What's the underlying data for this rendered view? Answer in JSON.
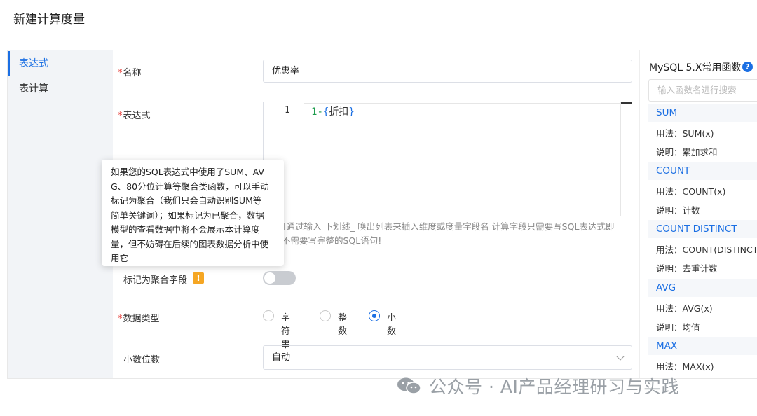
{
  "page": {
    "title": "新建计算度量"
  },
  "nav": {
    "items": [
      {
        "label": "表达式",
        "active": true
      },
      {
        "label": "表计算",
        "active": false
      }
    ]
  },
  "form": {
    "name": {
      "required_mark": "*",
      "label": "名称",
      "value": "优惠率"
    },
    "expression": {
      "required_mark": "*",
      "label": "表达式",
      "line_number": "1",
      "code": {
        "num": "1",
        "op": "-",
        "open": "{",
        "field": "折扣",
        "close": "}"
      },
      "hint_line1": "可通过输入 下划线_ 唤出列表来插入维度或度量字段名 计算字段只需要写SQL表达式即",
      "hint_line2": "不需要写完整的SQL语句!"
    },
    "aggregate": {
      "label": "标记为聚合字段",
      "warn_glyph": "!",
      "enabled": false
    },
    "data_type": {
      "required_mark": "*",
      "label": "数据类型",
      "options": [
        {
          "label": "字符串",
          "checked": false
        },
        {
          "label": "整数",
          "checked": false
        },
        {
          "label": "小数",
          "checked": true
        }
      ]
    },
    "decimals": {
      "label": "小数位数",
      "value": "自动"
    }
  },
  "tooltip": {
    "lines": [
      "如果您的SQL表达式中使用了SUM、AV",
      "G、80分位计算等聚合类函数，可以手动",
      "标记为聚合（我们只会自动识别SUM等",
      "简单关键词）；如果标记为已聚合，数据",
      "模型的查看数据中将不会展示本计算度",
      "量，但不妨碍在后续的图表数据分析中使",
      "用它"
    ]
  },
  "functions": {
    "title": "MySQL 5.X常用函数",
    "help_glyph": "?",
    "search_placeholder": "输入函数名进行搜索",
    "items": [
      {
        "name": "SUM",
        "usage": "用法：SUM(x)",
        "desc": "说明：累加求和"
      },
      {
        "name": "COUNT",
        "usage": "用法：COUNT(x)",
        "desc": "说明：计数"
      },
      {
        "name": "COUNT DISTINCT",
        "usage": "用法：COUNT(DISTINCT",
        "desc": "说明：去重计数"
      },
      {
        "name": "AVG",
        "usage": "用法：AVG(x)",
        "desc": "说明：均值"
      },
      {
        "name": "MAX",
        "usage": "用法：MAX(x)",
        "desc": ""
      }
    ]
  },
  "watermark": {
    "text": "公众号 · AI产品经理研习与实践"
  },
  "colors": {
    "accent": "#1b6fe3",
    "required": "#e53935",
    "warning": "#f5a623",
    "nav_bg": "#f2f4f7"
  }
}
